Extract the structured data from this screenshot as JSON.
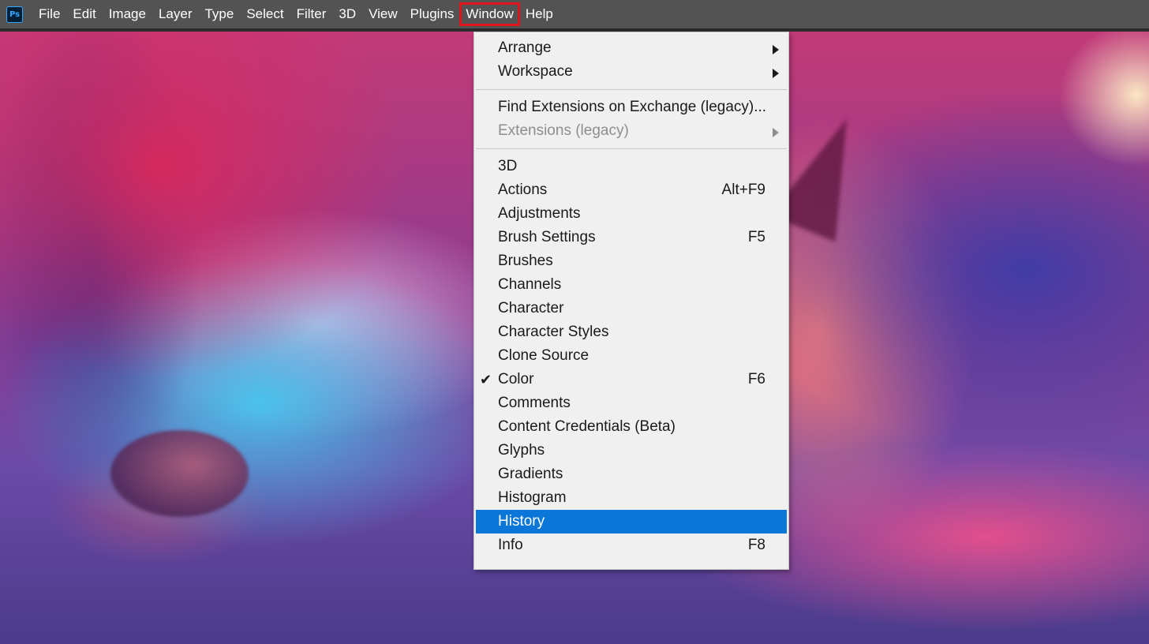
{
  "app": {
    "logo_text": "Ps",
    "menu": [
      "File",
      "Edit",
      "Image",
      "Layer",
      "Type",
      "Select",
      "Filter",
      "3D",
      "View",
      "Plugins",
      "Window",
      "Help"
    ],
    "highlighted_menu": "Window",
    "highlight_color": "#e0121b"
  },
  "dropdown": {
    "groups": [
      [
        {
          "label": "Arrange",
          "submenu": true
        },
        {
          "label": "Workspace",
          "submenu": true
        }
      ],
      [
        {
          "label": "Find Extensions on Exchange (legacy)..."
        },
        {
          "label": "Extensions (legacy)",
          "submenu": true,
          "disabled": true
        }
      ],
      [
        {
          "label": "3D"
        },
        {
          "label": "Actions",
          "shortcut": "Alt+F9"
        },
        {
          "label": "Adjustments"
        },
        {
          "label": "Brush Settings",
          "shortcut": "F5"
        },
        {
          "label": "Brushes"
        },
        {
          "label": "Channels"
        },
        {
          "label": "Character"
        },
        {
          "label": "Character Styles"
        },
        {
          "label": "Clone Source"
        },
        {
          "label": "Color",
          "shortcut": "F6",
          "checked": true
        },
        {
          "label": "Comments"
        },
        {
          "label": "Content Credentials (Beta)"
        },
        {
          "label": "Glyphs"
        },
        {
          "label": "Gradients"
        },
        {
          "label": "Histogram"
        },
        {
          "label": "History",
          "selected": true
        },
        {
          "label": "Info",
          "shortcut": "F8"
        }
      ]
    ],
    "selection_color": "#0a76d8",
    "check_glyph": "✔"
  }
}
